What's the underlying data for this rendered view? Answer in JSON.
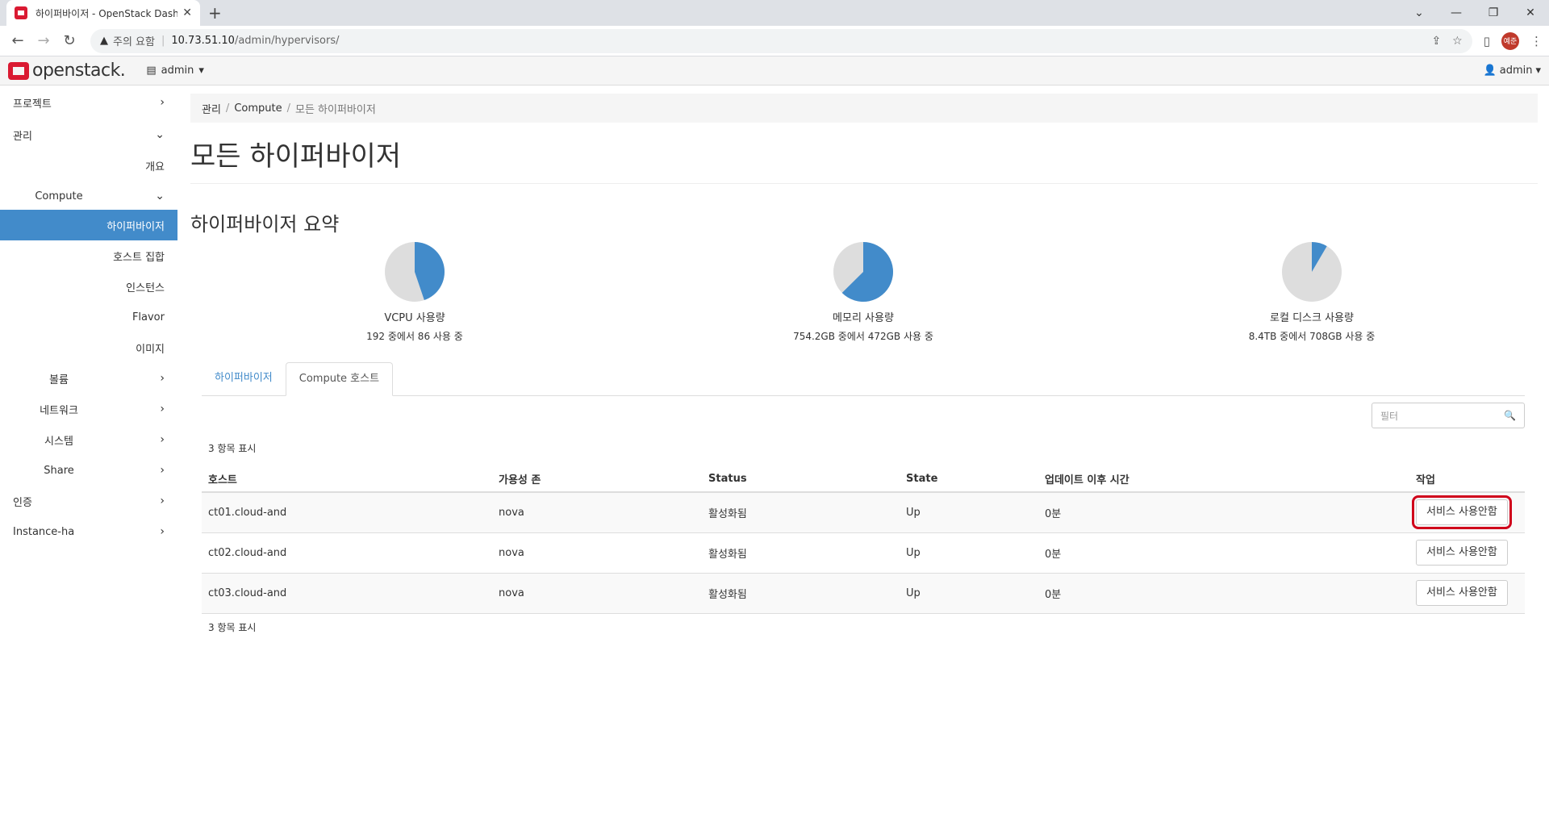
{
  "browser": {
    "tab_title": "하이퍼바이저 - OpenStack Dash",
    "url_warning": "주의 요함",
    "url_host": "10.73.51.10",
    "url_path": "/admin/hypervisors/",
    "avatar_text": "예준"
  },
  "header": {
    "logo_text": "openstack.",
    "project": "admin",
    "user": "admin"
  },
  "sidebar": {
    "items": [
      {
        "label": "프로젝트"
      },
      {
        "label": "관리"
      },
      {
        "label": "개요"
      },
      {
        "label": "Compute"
      },
      {
        "label": "하이퍼바이저"
      },
      {
        "label": "호스트 집합"
      },
      {
        "label": "인스턴스"
      },
      {
        "label": "Flavor"
      },
      {
        "label": "이미지"
      },
      {
        "label": "볼륨"
      },
      {
        "label": "네트워크"
      },
      {
        "label": "시스템"
      },
      {
        "label": "Share"
      },
      {
        "label": "인증"
      },
      {
        "label": "Instance-ha"
      }
    ]
  },
  "breadcrumb": {
    "root": "관리",
    "mid": "Compute",
    "current": "모든 하이퍼바이저"
  },
  "page_title": "모든 하이퍼바이저",
  "summary_title": "하이퍼바이저 요약",
  "chart_data": {
    "type": "pie",
    "charts": [
      {
        "label": "VCPU 사용량",
        "sub": "192 중에서 86 사용 중",
        "used": 86,
        "total": 192
      },
      {
        "label": "메모리 사용량",
        "sub": "754.2GB 중에서 472GB 사용 중",
        "used": 472,
        "total": 754.2
      },
      {
        "label": "로컬 디스크 사용량",
        "sub": "8.4TB 중에서 708GB 사용 중",
        "used": 0.708,
        "total": 8.4
      }
    ],
    "colors": {
      "used": "#428bca",
      "free": "#dddddd"
    }
  },
  "tabs": [
    {
      "label": "하이퍼바이저"
    },
    {
      "label": "Compute 호스트"
    }
  ],
  "filter_placeholder": "필터",
  "count_text": "3 항목 표시",
  "table": {
    "headers": [
      "호스트",
      "가용성 존",
      "Status",
      "State",
      "업데이트 이후 시간",
      "작업"
    ],
    "rows": [
      {
        "host": "ct01.cloud-and",
        "zone": "nova",
        "status": "활성화됨",
        "state": "Up",
        "updated": "0분",
        "action": "서비스 사용안함"
      },
      {
        "host": "ct02.cloud-and",
        "zone": "nova",
        "status": "활성화됨",
        "state": "Up",
        "updated": "0분",
        "action": "서비스 사용안함"
      },
      {
        "host": "ct03.cloud-and",
        "zone": "nova",
        "status": "활성화됨",
        "state": "Up",
        "updated": "0분",
        "action": "서비스 사용안함"
      }
    ]
  }
}
